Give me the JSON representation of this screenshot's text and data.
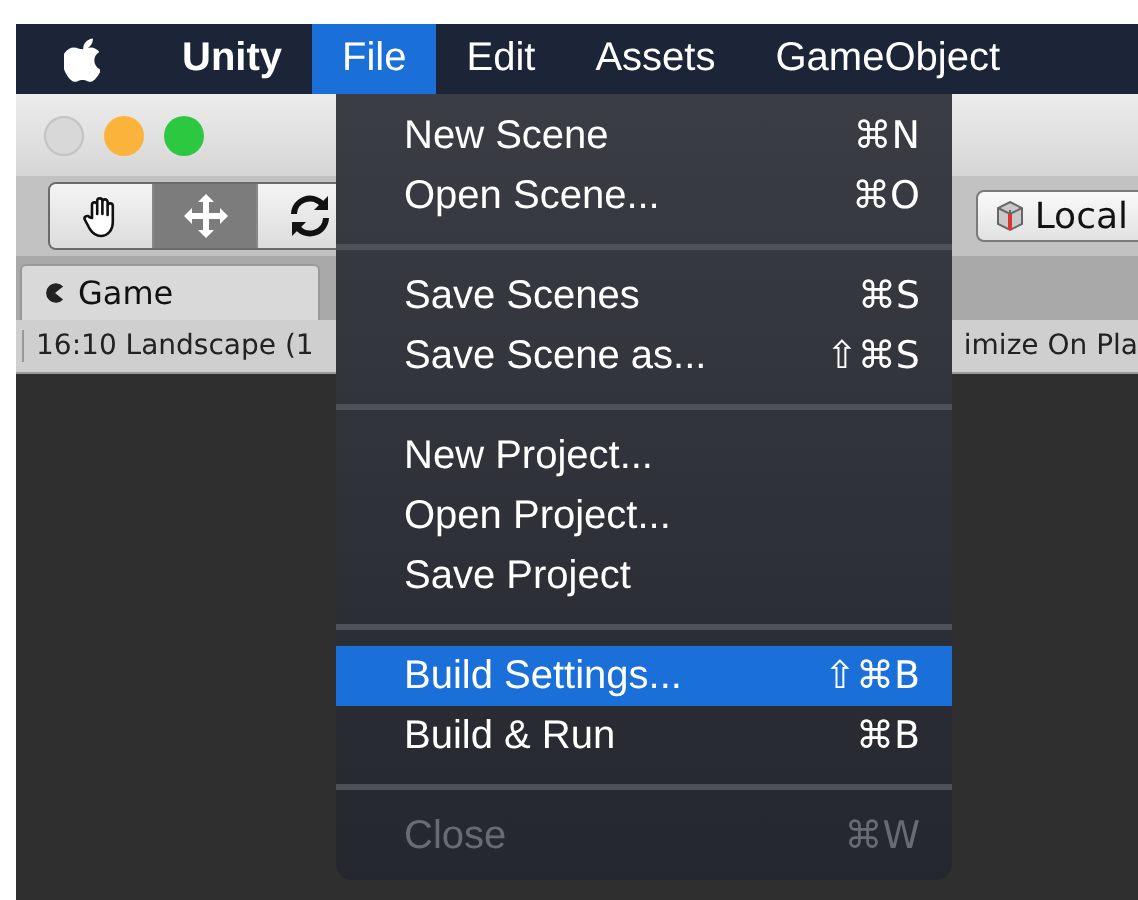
{
  "menubar": {
    "items": [
      {
        "label": "Unity",
        "kind": "app",
        "selected": false
      },
      {
        "label": "File",
        "kind": "menu",
        "selected": true
      },
      {
        "label": "Edit",
        "kind": "menu",
        "selected": false
      },
      {
        "label": "Assets",
        "kind": "menu",
        "selected": false
      },
      {
        "label": "GameObject",
        "kind": "menu",
        "selected": false
      }
    ]
  },
  "window": {
    "tools": [
      {
        "kind": "hand",
        "selected": false
      },
      {
        "kind": "move",
        "selected": true
      },
      {
        "kind": "rotate",
        "selected": false
      }
    ],
    "pivot_button": {
      "label": "Local"
    },
    "tab": {
      "label": "Game"
    },
    "aspect": "16:10 Landscape (1",
    "maximize": "imize On Pla"
  },
  "file_menu": {
    "items": [
      {
        "kind": "item",
        "label": "New Scene",
        "shortcut": "⌘N",
        "selected": false,
        "disabled": false
      },
      {
        "kind": "item",
        "label": "Open Scene...",
        "shortcut": "⌘O",
        "selected": false,
        "disabled": false
      },
      {
        "kind": "separator"
      },
      {
        "kind": "item",
        "label": "Save Scenes",
        "shortcut": "⌘S",
        "selected": false,
        "disabled": false
      },
      {
        "kind": "item",
        "label": "Save Scene as...",
        "shortcut": "⇧⌘S",
        "selected": false,
        "disabled": false
      },
      {
        "kind": "separator"
      },
      {
        "kind": "item",
        "label": "New Project...",
        "selected": false,
        "disabled": false
      },
      {
        "kind": "item",
        "label": "Open Project...",
        "selected": false,
        "disabled": false
      },
      {
        "kind": "item",
        "label": "Save Project",
        "selected": false,
        "disabled": false
      },
      {
        "kind": "separator"
      },
      {
        "kind": "item",
        "label": "Build Settings...",
        "shortcut": "⇧⌘B",
        "selected": true,
        "disabled": false
      },
      {
        "kind": "item",
        "label": "Build & Run",
        "shortcut": "⌘B",
        "selected": false,
        "disabled": false
      },
      {
        "kind": "separator"
      },
      {
        "kind": "item",
        "label": "Close",
        "shortcut": "⌘W",
        "selected": false,
        "disabled": true
      }
    ]
  }
}
